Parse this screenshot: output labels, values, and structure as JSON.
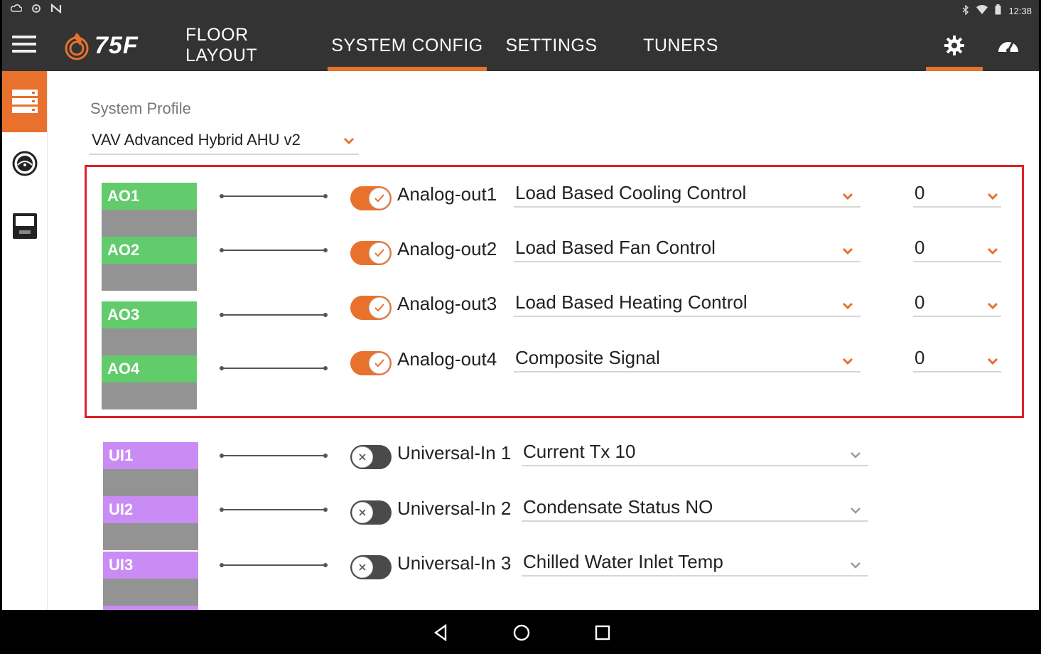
{
  "status_bar": {
    "left_icons": [
      "cloud-icon",
      "sync-icon",
      "nfc-icon"
    ],
    "right_icons": [
      "bluetooth-icon",
      "wifi-icon",
      "battery-icon"
    ],
    "time": "12:38"
  },
  "app_bar": {
    "logo_text": "75F",
    "nav": [
      {
        "label": "FLOOR LAYOUT",
        "active": false
      },
      {
        "label": "SYSTEM CONFIG",
        "active": true
      },
      {
        "label": "SETTINGS",
        "active": false
      },
      {
        "label": "TUNERS",
        "active": false
      }
    ],
    "icons": [
      "gear-icon",
      "dashboard-gauge-icon"
    ]
  },
  "sidebar": {
    "items": [
      "system-profile-icon",
      "fan-dial-icon",
      "thermostat-module-icon"
    ]
  },
  "system_profile": {
    "label": "System Profile",
    "value": "VAV Advanced Hybrid AHU v2"
  },
  "analog_outputs": [
    {
      "pin": "AO1",
      "enabled": true,
      "name": "Analog-out1",
      "mode": "Load Based Cooling Control",
      "value": "0"
    },
    {
      "pin": "AO2",
      "enabled": true,
      "name": "Analog-out2",
      "mode": "Load Based Fan Control",
      "value": "0"
    },
    {
      "pin": "AO3",
      "enabled": true,
      "name": "Analog-out3",
      "mode": "Load Based Heating Control",
      "value": "0"
    },
    {
      "pin": "AO4",
      "enabled": true,
      "name": "Analog-out4",
      "mode": "Composite Signal",
      "value": "0"
    }
  ],
  "universal_inputs": [
    {
      "pin": "UI1",
      "enabled": false,
      "name": "Universal-In 1",
      "mode": "Current Tx 10"
    },
    {
      "pin": "UI2",
      "enabled": false,
      "name": "Universal-In 2",
      "mode": "Condensate Status NO"
    },
    {
      "pin": "UI3",
      "enabled": false,
      "name": "Universal-In 3",
      "mode": "Chilled Water Inlet Temp"
    }
  ],
  "colors": {
    "accent": "#e8712e",
    "highlight_border": "#e02027",
    "analog_pin": "#62cb6c",
    "universal_pin": "#c98cf5",
    "app_bar": "#333333"
  }
}
